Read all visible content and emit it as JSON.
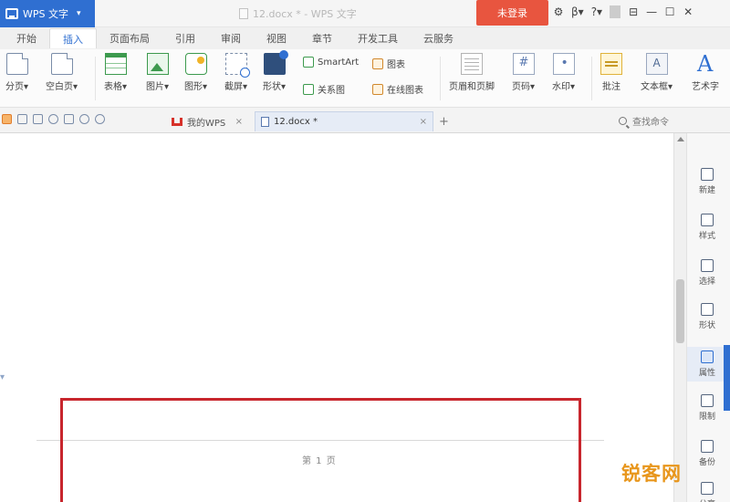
{
  "app": {
    "name": "WPS 文字",
    "caret": "▾"
  },
  "window": {
    "doc_title": "12.docx * - WPS 文字",
    "login_label": "未登录",
    "controls": [
      "⚙",
      "β▾",
      "?▾",
      "⊟",
      "—",
      "☐",
      "✕"
    ]
  },
  "ribbon_tabs": [
    "开始",
    "插入",
    "页面布局",
    "引用",
    "审阅",
    "视图",
    "章节",
    "开发工具",
    "云服务"
  ],
  "active_tab": "插入",
  "ribbon": {
    "page_break": "分页▾",
    "blank_page": "空白页▾",
    "table": "表格▾",
    "picture": "图片▾",
    "shape": "图形▾",
    "screenshot": "截屏▾",
    "shapes": "形状▾",
    "smartart": "SmartArt",
    "chart": "图表",
    "flowchart": "关系图",
    "online_chart": "在线图表",
    "header_footer": "页眉和页脚",
    "page_number": "页码▾",
    "watermark": "水印▾",
    "comment": "批注",
    "textbox": "文本框▾",
    "wordart": "艺术字"
  },
  "quickbar": {
    "wps_tab": "我的WPS",
    "doc_tab": "12.docx *",
    "close": "×",
    "new_tab": "+",
    "search_placeholder": "查找命令"
  },
  "document": {
    "page_label": "第 1 页",
    "left_hint": "▾"
  },
  "right_pane": [
    "新建",
    "样式",
    "选择",
    "形状",
    "属性",
    "限制",
    "备份",
    "分享"
  ],
  "right_pane_active": "属性",
  "watermark_text": "锐客网",
  "colors": {
    "accent": "#2f6fd1",
    "login": "#e8553f",
    "frame": "#c8262d",
    "watermark": "#e8961c"
  }
}
